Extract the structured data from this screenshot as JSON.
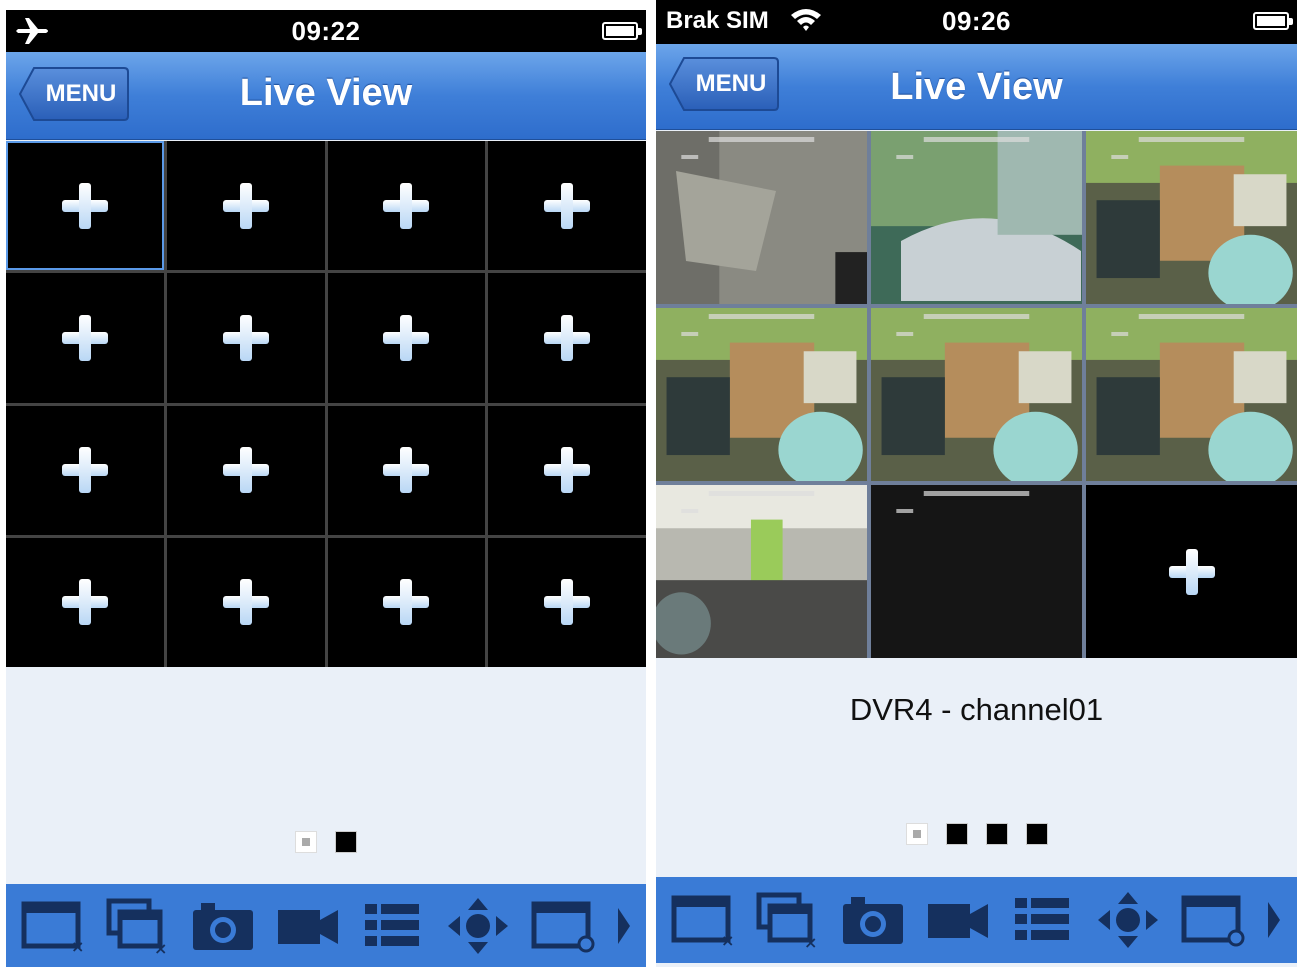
{
  "left_screen": {
    "status": {
      "time": "09:22",
      "mode_icon": "airplane-icon",
      "battery_icon": "battery-icon"
    },
    "navbar": {
      "back_label": "MENU",
      "title": "Live View"
    },
    "grid": {
      "rows": 4,
      "cols": 4,
      "cell_icon": "plus-icon",
      "selected_cell": 1
    },
    "page_dots": {
      "count": 2,
      "active": 1
    },
    "toolbar": {
      "icons": [
        "close-window-icon",
        "close-all-windows-icon",
        "snapshot-camera-icon",
        "record-video-icon",
        "list-icon",
        "ptz-control-icon",
        "window-playback-icon",
        "more-arrow-icon"
      ]
    }
  },
  "right_screen": {
    "status": {
      "carrier": "Brak SIM",
      "time": "09:26",
      "wifi_icon": "wifi-icon",
      "battery_icon": "battery-icon"
    },
    "navbar": {
      "back_label": "MENU",
      "title": "Live View"
    },
    "grid": {
      "rows": 3,
      "cols": 3,
      "selected_cell": 1
    },
    "cameras": [
      {
        "type": "feed",
        "scene": "wall"
      },
      {
        "type": "feed",
        "scene": "room-green"
      },
      {
        "type": "feed",
        "scene": "office"
      },
      {
        "type": "feed",
        "scene": "office"
      },
      {
        "type": "feed",
        "scene": "office"
      },
      {
        "type": "feed",
        "scene": "office"
      },
      {
        "type": "feed",
        "scene": "hall"
      },
      {
        "type": "empty-feed",
        "scene": "dark"
      },
      {
        "type": "add",
        "scene": ""
      }
    ],
    "channel_label": "DVR4 - channel01",
    "page_dots": {
      "count": 4,
      "active": 1
    },
    "toolbar": {
      "icons": [
        "close-window-icon",
        "close-all-windows-icon",
        "snapshot-camera-icon",
        "record-video-icon",
        "list-icon",
        "ptz-control-icon",
        "window-playback-icon",
        "more-arrow-icon"
      ]
    }
  }
}
